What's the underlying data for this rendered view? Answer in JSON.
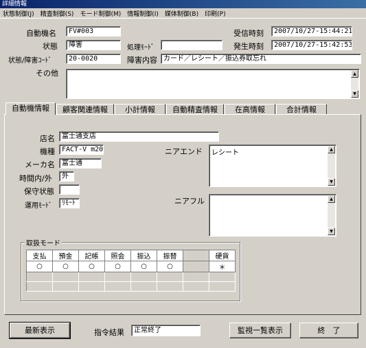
{
  "window": {
    "title": "詳細情報"
  },
  "menu": [
    "状態制御(J)",
    "精査制御(S)",
    "モード制御(M)",
    "情報制御(I)",
    "媒体制御(B)",
    "印刷(P)"
  ],
  "header": {
    "machine_name_label": "自動機名",
    "machine_name": "FV#003",
    "status_label": "状態",
    "status": "障害",
    "process_mode_label": "処理ﾓｰﾄﾞ",
    "process_mode": "",
    "status_code_label": "状態/障害ｺｰﾄﾞ",
    "status_code": "20-0020",
    "fault_detail_label": "障害内容",
    "fault_detail": "カード／レシート／振込券取忘れ",
    "received_time_label": "受信時刻",
    "received_time": "2007/10/27-15:44:21",
    "occurred_time_label": "発生時刻",
    "occurred_time": "2007/10/27-15:42:53",
    "other_label": "その他",
    "other": ""
  },
  "tabs": [
    "自動機情報",
    "顧客関連情報",
    "小計情報",
    "自動精査情報",
    "在高情報",
    "合計情報"
  ],
  "machine_info": {
    "store_label": "店名",
    "store": "富士通支店",
    "model_label": "機種",
    "model": "FACT-V m20",
    "maker_label": "メーカ名",
    "maker": "富士通",
    "hours_label": "時間内/外",
    "hours": "外",
    "maintenance_label": "保守状態",
    "maintenance": "",
    "operation_mode_label": "運用ﾓｰﾄﾞ",
    "operation_mode": "ﾘﾓｰﾄ",
    "near_end_label": "ニアエンド",
    "near_end": "レシート",
    "near_full_label": "ニアフル",
    "near_full": ""
  },
  "modes": {
    "label": "取扱モード",
    "headers": [
      "支払",
      "預金",
      "記帳",
      "照会",
      "振込",
      "振替",
      "",
      "硬貨"
    ],
    "values": [
      "○",
      "○",
      "○",
      "○",
      "○",
      "○",
      "",
      "＊"
    ]
  },
  "footer": {
    "refresh_label": "最新表示",
    "command_result_label": "指令結果",
    "command_result": "正常終了",
    "monitor_list_label": "監視一覧表示",
    "close_label": "終　了"
  }
}
